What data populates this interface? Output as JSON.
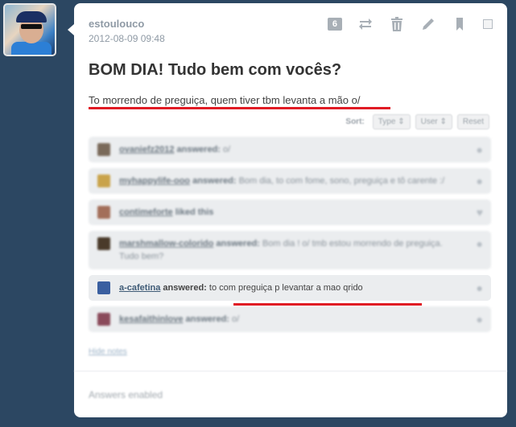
{
  "post": {
    "username": "estoulouco",
    "timestamp": "2012-08-09 09:48",
    "notes_count": "6",
    "title": "BOM DIA! Tudo bem com vocês?",
    "body": "To morrendo de preguiça, quem tiver tbm levanta a mão o/"
  },
  "controls": {
    "icons": [
      "reblog-icon",
      "delete-icon",
      "edit-icon",
      "bookmark-icon"
    ]
  },
  "sort": {
    "label": "Sort:",
    "type_btn": "Type ⇕",
    "user_btn": "User ⇕",
    "reset_btn": "Reset"
  },
  "notes": [
    {
      "user": "ovaniefz2012",
      "verb": "answered:",
      "text": "o/",
      "avatar_color": "#7a6a5a"
    },
    {
      "user": "myhappylife-ooo",
      "verb": "answered:",
      "text": "Bom dia, to com fome, sono, preguiça e tô carente :/",
      "avatar_color": "#c9a34a"
    },
    {
      "user": "contimeforte",
      "verb": "liked this",
      "text": "",
      "avatar_color": "#a36f5a"
    },
    {
      "user": "marshmallow-colorido",
      "verb": "answered:",
      "text": "Bom dia ! o/ tmb estou morrendo de preguiça. Tudo bem?",
      "avatar_color": "#4a3a2a"
    },
    {
      "user": "a-cafetina",
      "verb": "answered:",
      "text": "to com preguiça p levantar a mao qrido",
      "avatar_color": "#3a5fa0"
    },
    {
      "user": "kesafaithinlove",
      "verb": "answered:",
      "text": "o/",
      "avatar_color": "#8a4a5a"
    }
  ],
  "hide_notes": "Hide notes",
  "answers_status": "Answers enabled",
  "colors": {
    "background": "#2c4762",
    "highlight_red": "#e01b24"
  }
}
